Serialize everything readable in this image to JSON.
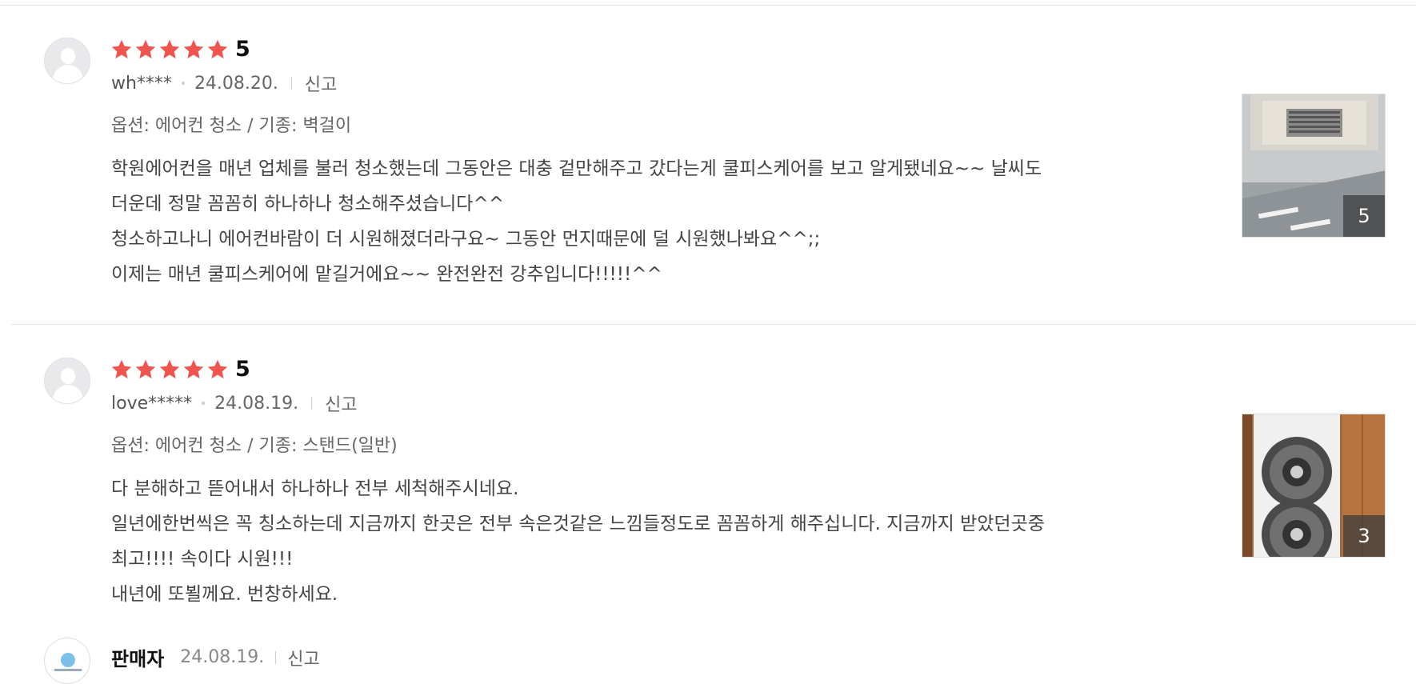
{
  "colors": {
    "star": "#f0544f",
    "divider": "#e6e6e6",
    "count_badge": "#3c3c3c"
  },
  "reviews": [
    {
      "rating": 5,
      "rating_text": "5",
      "user": "wh****",
      "date": "24.08.20.",
      "report_label": "신고",
      "option": "옵션: 에어컨 청소 / 기종: 벽걸이",
      "lines": [
        "학원에어컨을 매년 업체를 불러 청소했는데 그동안은 대충 겉만해주고 갔다는게 쿨피스케어를 보고 알게됐네요~~ 날씨도",
        "더운데 정말 꼼꼼히 하나하나 청소해주셨습니다^^",
        "청소하고나니 에어컨바람이 더 시원해졌더라구요~ 그동안 먼지때문에 덜 시원했나봐요^^;;",
        "이제는 매년 쿨피스케어에 맡길거에요~~ 완전완전 강추입니다!!!!!^^"
      ],
      "photo_count": "5",
      "photo_icon": "ceiling-cassette-aircon-photo"
    },
    {
      "rating": 5,
      "rating_text": "5",
      "user": "love*****",
      "date": "24.08.19.",
      "report_label": "신고",
      "option": "옵션: 에어컨 청소 / 기종: 스탠드(일반)",
      "lines": [
        "다 분해하고 뜯어내서 하나하나 전부 세척해주시네요.",
        "일년에한번씩은 꼭 칭소하는데 지금까지 한곳은 전부 속은것같은 느낌들정도로 꼼꼼하게 해주십니다. 지금까지 받았던곳중",
        "최고!!!! 속이다 시원!!!",
        "내년에 또뵐께요. 번창하세요."
      ],
      "photo_count": "3",
      "photo_icon": "aircon-fan-parts-photo"
    }
  ],
  "seller_reply": {
    "label": "판매자",
    "date": "24.08.19.",
    "report_label": "신고"
  }
}
